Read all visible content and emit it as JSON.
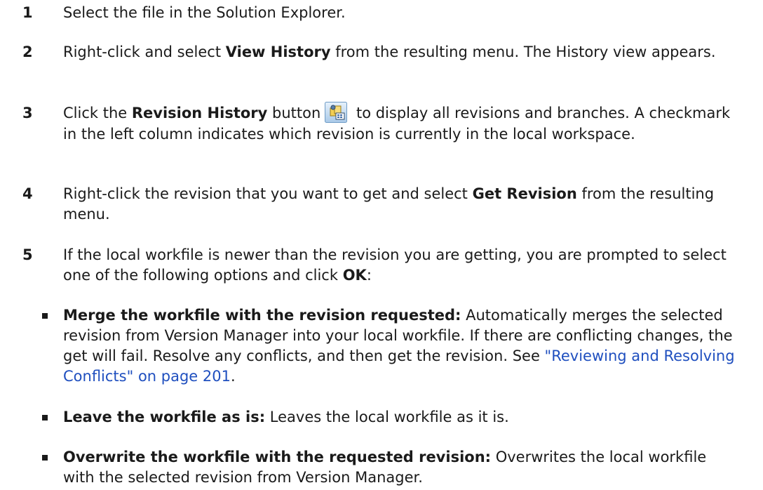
{
  "steps": [
    {
      "num": "1",
      "text": "Select the file in the Solution Explorer."
    },
    {
      "num": "2",
      "pre": "Right-click and select ",
      "bold": "View History",
      "post": " from the resulting menu. The History view appears."
    },
    {
      "num": "3",
      "pre": "Click the ",
      "bold": "Revision History",
      "mid": " button",
      "icon": "revision-history-icon",
      "post": " to display all revisions and branches. A checkmark in the left column indicates which revision is currently in the local workspace."
    },
    {
      "num": "4",
      "pre": "Right-click the revision that you want to get and select ",
      "bold": "Get Revision",
      "post": " from the resulting menu."
    },
    {
      "num": "5",
      "pre": "If the local workfile is newer than the revision you are getting, you are prompted to select one of the following options and click ",
      "bold": "OK",
      "post": ":"
    }
  ],
  "options": [
    {
      "bold": "Merge the workfile with the revision requested:",
      "text": " Automatically merges the selected revision from Version Manager into your local workfile. If there are conflicting changes, the get will fail. Resolve any conflicts, and then get the revision. See ",
      "link": "\"Reviewing and Resolving Conflicts\" on page 201",
      "after": "."
    },
    {
      "bold": "Leave the workfile as is:",
      "text": " Leaves the local workfile as it is."
    },
    {
      "bold": "Overwrite the workfile with the requested revision:",
      "text": " Overwrites the local workfile with the selected revision from Version Manager."
    }
  ]
}
